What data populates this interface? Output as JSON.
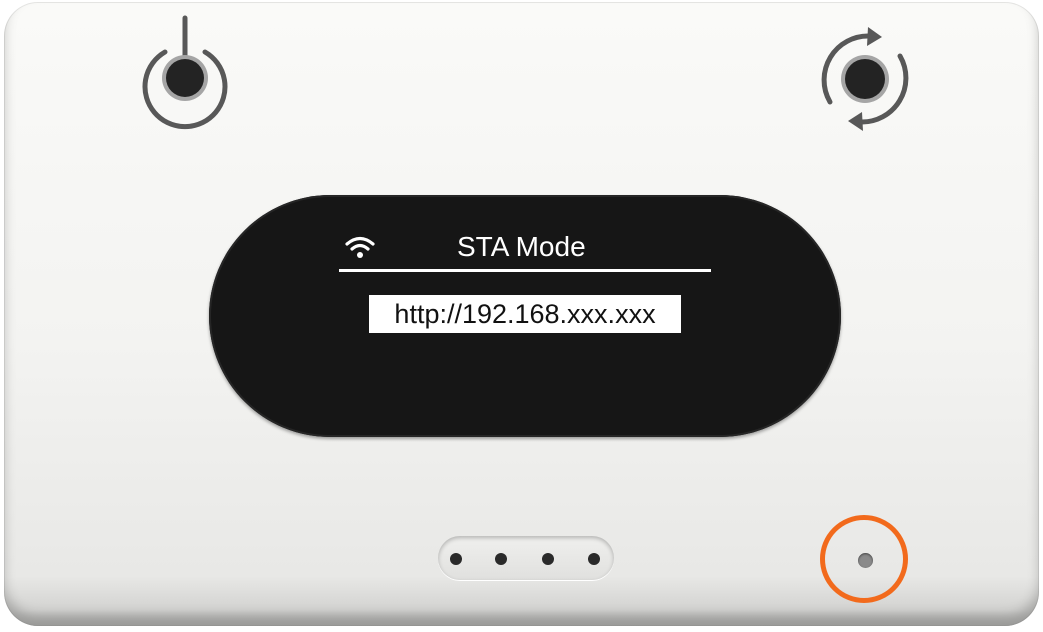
{
  "screen": {
    "mode_title": "STA Mode",
    "url": "http://192.168.xxx.xxx"
  },
  "icons": {
    "power": "power-icon",
    "reset": "refresh-icon",
    "wifi": "wifi-icon"
  },
  "colors": {
    "screen_bg": "#161616",
    "highlight_ring": "#f26a1c",
    "device_body": "#f5f5f3"
  }
}
